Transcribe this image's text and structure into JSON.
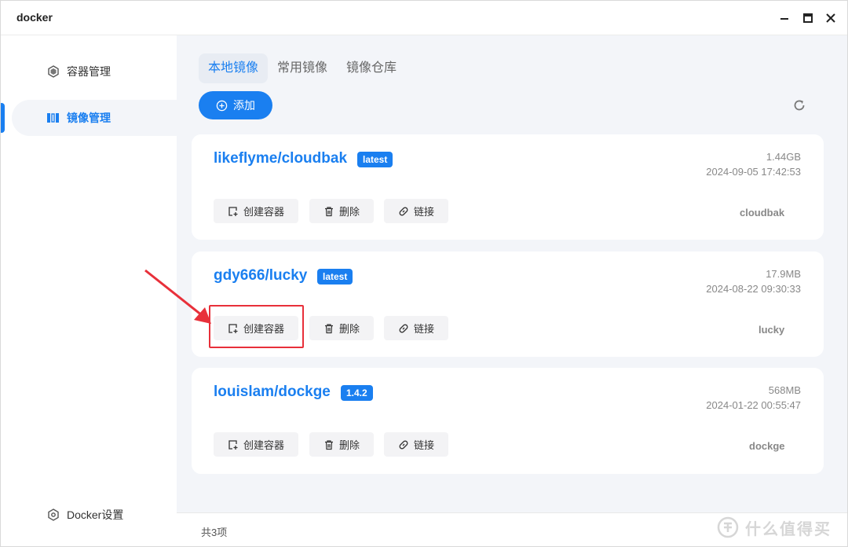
{
  "window": {
    "title": "docker"
  },
  "sidebar": {
    "items": [
      {
        "label": "容器管理"
      },
      {
        "label": "镜像管理"
      }
    ],
    "settings_label": "Docker设置"
  },
  "tabs": [
    {
      "label": "本地镜像"
    },
    {
      "label": "常用镜像"
    },
    {
      "label": "镜像仓库"
    }
  ],
  "toolbar": {
    "add_label": "添加"
  },
  "actions": {
    "create": "创建容器",
    "delete": "删除",
    "link": "链接"
  },
  "images": [
    {
      "name": "likeflyme/cloudbak",
      "tag": "latest",
      "size": "1.44GB",
      "created": "2024-09-05 17:42:53",
      "short_name": "cloudbak"
    },
    {
      "name": "gdy666/lucky",
      "tag": "latest",
      "size": "17.9MB",
      "created": "2024-08-22 09:30:33",
      "short_name": "lucky"
    },
    {
      "name": "louislam/dockge",
      "tag": "1.4.2",
      "size": "568MB",
      "created": "2024-01-22 00:55:47",
      "short_name": "dockge"
    }
  ],
  "footer": {
    "count_text": "共3项"
  },
  "watermark": {
    "text": "什么值得买"
  },
  "colors": {
    "accent": "#1a7ff0",
    "highlight": "#e8303a",
    "background": "#f3f5f9"
  }
}
